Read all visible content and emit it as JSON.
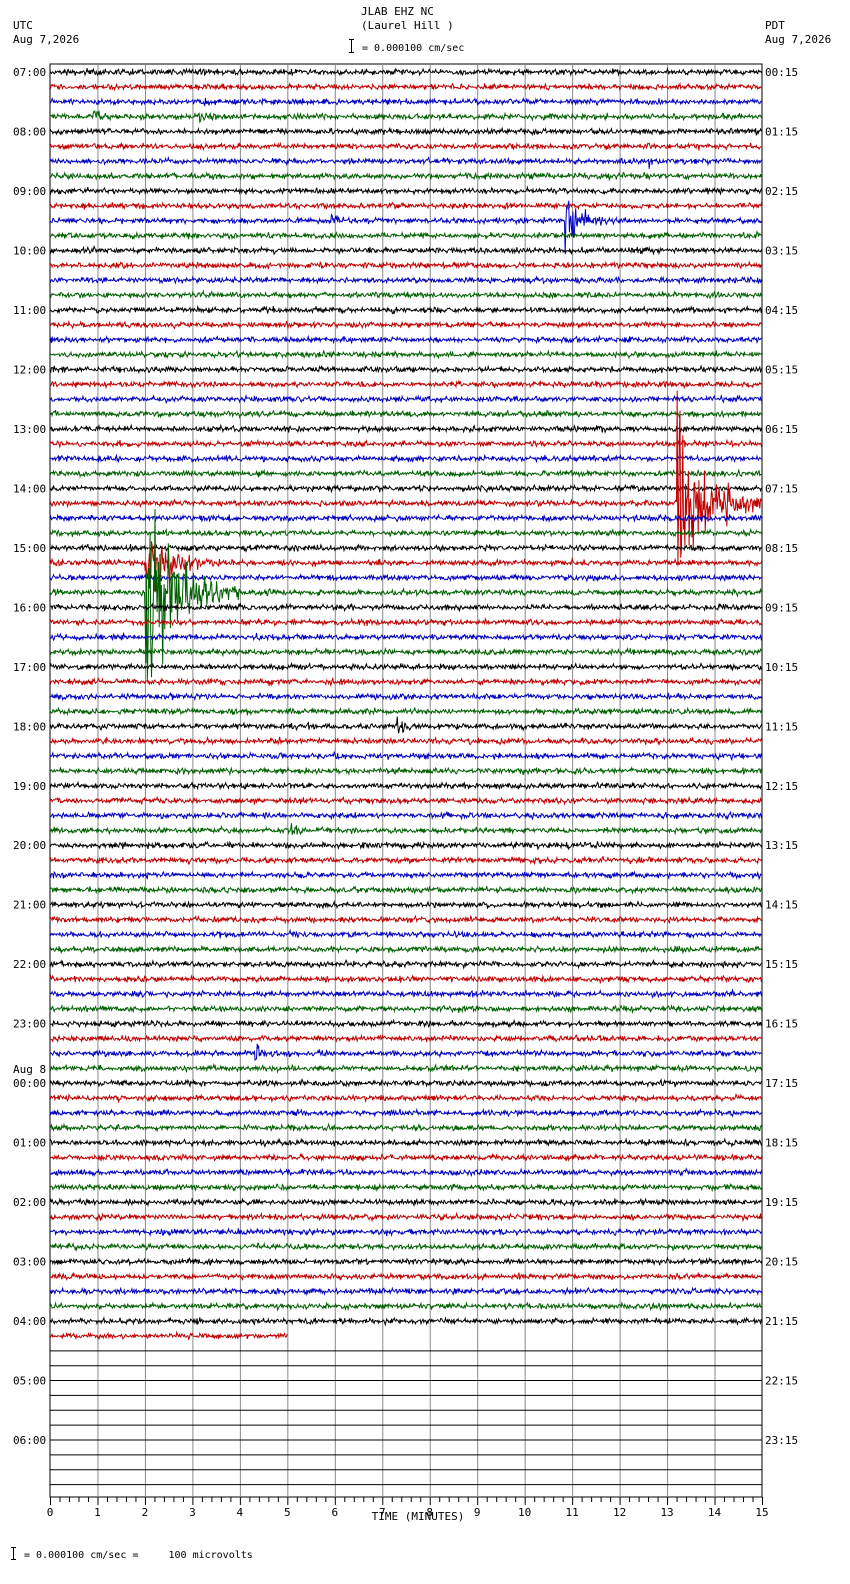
{
  "header": {
    "station_line": "JLAB EHZ NC",
    "location_line": "(Laurel Hill )",
    "scale_text": "= 0.000100 cm/sec",
    "left_tz": "UTC",
    "left_date": "Aug 7,2026",
    "right_tz": "PDT",
    "right_date": "Aug 7,2026"
  },
  "footer": {
    "scale_text": "= 0.000100 cm/sec =     100 microvolts"
  },
  "chart_data": {
    "type": "line",
    "title": "JLAB EHZ NC (Laurel Hill )",
    "xlabel": "TIME (MINUTES)",
    "x_ticks": [
      "0",
      "1",
      "2",
      "3",
      "4",
      "5",
      "6",
      "7",
      "8",
      "9",
      "10",
      "11",
      "12",
      "13",
      "14",
      "15"
    ],
    "xlim": [
      0,
      15
    ],
    "grid": true,
    "trace_colors": [
      "#000000",
      "#c00000",
      "#0000c0",
      "#006000"
    ],
    "total_traces": 96,
    "recorded_traces": 86,
    "last_trace_end_minute": 5,
    "left_labels": [
      {
        "trace": 0,
        "text": "07:00"
      },
      {
        "trace": 4,
        "text": "08:00"
      },
      {
        "trace": 8,
        "text": "09:00"
      },
      {
        "trace": 12,
        "text": "10:00"
      },
      {
        "trace": 16,
        "text": "11:00"
      },
      {
        "trace": 20,
        "text": "12:00"
      },
      {
        "trace": 24,
        "text": "13:00"
      },
      {
        "trace": 28,
        "text": "14:00"
      },
      {
        "trace": 32,
        "text": "15:00"
      },
      {
        "trace": 36,
        "text": "16:00"
      },
      {
        "trace": 40,
        "text": "17:00"
      },
      {
        "trace": 44,
        "text": "18:00"
      },
      {
        "trace": 48,
        "text": "19:00"
      },
      {
        "trace": 52,
        "text": "20:00"
      },
      {
        "trace": 56,
        "text": "21:00"
      },
      {
        "trace": 60,
        "text": "22:00"
      },
      {
        "trace": 64,
        "text": "23:00"
      },
      {
        "trace": 68,
        "text": "00:00",
        "date": "Aug 8"
      },
      {
        "trace": 72,
        "text": "01:00"
      },
      {
        "trace": 76,
        "text": "02:00"
      },
      {
        "trace": 80,
        "text": "03:00"
      },
      {
        "trace": 84,
        "text": "04:00"
      },
      {
        "trace": 88,
        "text": "05:00"
      },
      {
        "trace": 92,
        "text": "06:00"
      }
    ],
    "right_labels": [
      {
        "trace": 0,
        "text": "00:15"
      },
      {
        "trace": 4,
        "text": "01:15"
      },
      {
        "trace": 8,
        "text": "02:15"
      },
      {
        "trace": 12,
        "text": "03:15"
      },
      {
        "trace": 16,
        "text": "04:15"
      },
      {
        "trace": 20,
        "text": "05:15"
      },
      {
        "trace": 24,
        "text": "06:15"
      },
      {
        "trace": 28,
        "text": "07:15"
      },
      {
        "trace": 32,
        "text": "08:15"
      },
      {
        "trace": 36,
        "text": "09:15"
      },
      {
        "trace": 40,
        "text": "10:15"
      },
      {
        "trace": 44,
        "text": "11:15"
      },
      {
        "trace": 48,
        "text": "12:15"
      },
      {
        "trace": 52,
        "text": "13:15"
      },
      {
        "trace": 56,
        "text": "14:15"
      },
      {
        "trace": 60,
        "text": "15:15"
      },
      {
        "trace": 64,
        "text": "16:15"
      },
      {
        "trace": 68,
        "text": "17:15"
      },
      {
        "trace": 72,
        "text": "18:15"
      },
      {
        "trace": 76,
        "text": "19:15"
      },
      {
        "trace": 80,
        "text": "20:15"
      },
      {
        "trace": 84,
        "text": "21:15"
      },
      {
        "trace": 88,
        "text": "22:15"
      },
      {
        "trace": 92,
        "text": "23:15"
      }
    ],
    "events": [
      {
        "trace": 10,
        "minute": 5.9,
        "amplitude": 0.9,
        "duration": 0.5
      },
      {
        "trace": 10,
        "minute": 10.85,
        "amplitude": 2.5,
        "duration": 1.0
      },
      {
        "trace": 6,
        "minute": 12.6,
        "amplitude": 0.4,
        "duration": 0.3
      },
      {
        "trace": 29,
        "minute": 13.2,
        "amplitude": 9.0,
        "duration": 2.0
      },
      {
        "trace": 33,
        "minute": 2.0,
        "amplitude": 4.0,
        "duration": 1.6
      },
      {
        "trace": 35,
        "minute": 2.0,
        "amplitude": 10.0,
        "duration": 2.0
      },
      {
        "trace": 51,
        "minute": 5.0,
        "amplitude": 0.8,
        "duration": 0.5
      },
      {
        "trace": 66,
        "minute": 4.3,
        "amplitude": 1.0,
        "duration": 0.5
      },
      {
        "trace": 2,
        "minute": 3.2,
        "amplitude": 0.6,
        "duration": 0.5
      },
      {
        "trace": 3,
        "minute": 3.1,
        "amplitude": 0.6,
        "duration": 0.5
      },
      {
        "trace": 3,
        "minute": 0.9,
        "amplitude": 0.6,
        "duration": 0.5
      },
      {
        "trace": 44,
        "minute": 7.3,
        "amplitude": 0.5,
        "duration": 1.0
      },
      {
        "trace": 73,
        "minute": 9.8,
        "amplitude": 0.5,
        "duration": 0.4
      }
    ]
  }
}
